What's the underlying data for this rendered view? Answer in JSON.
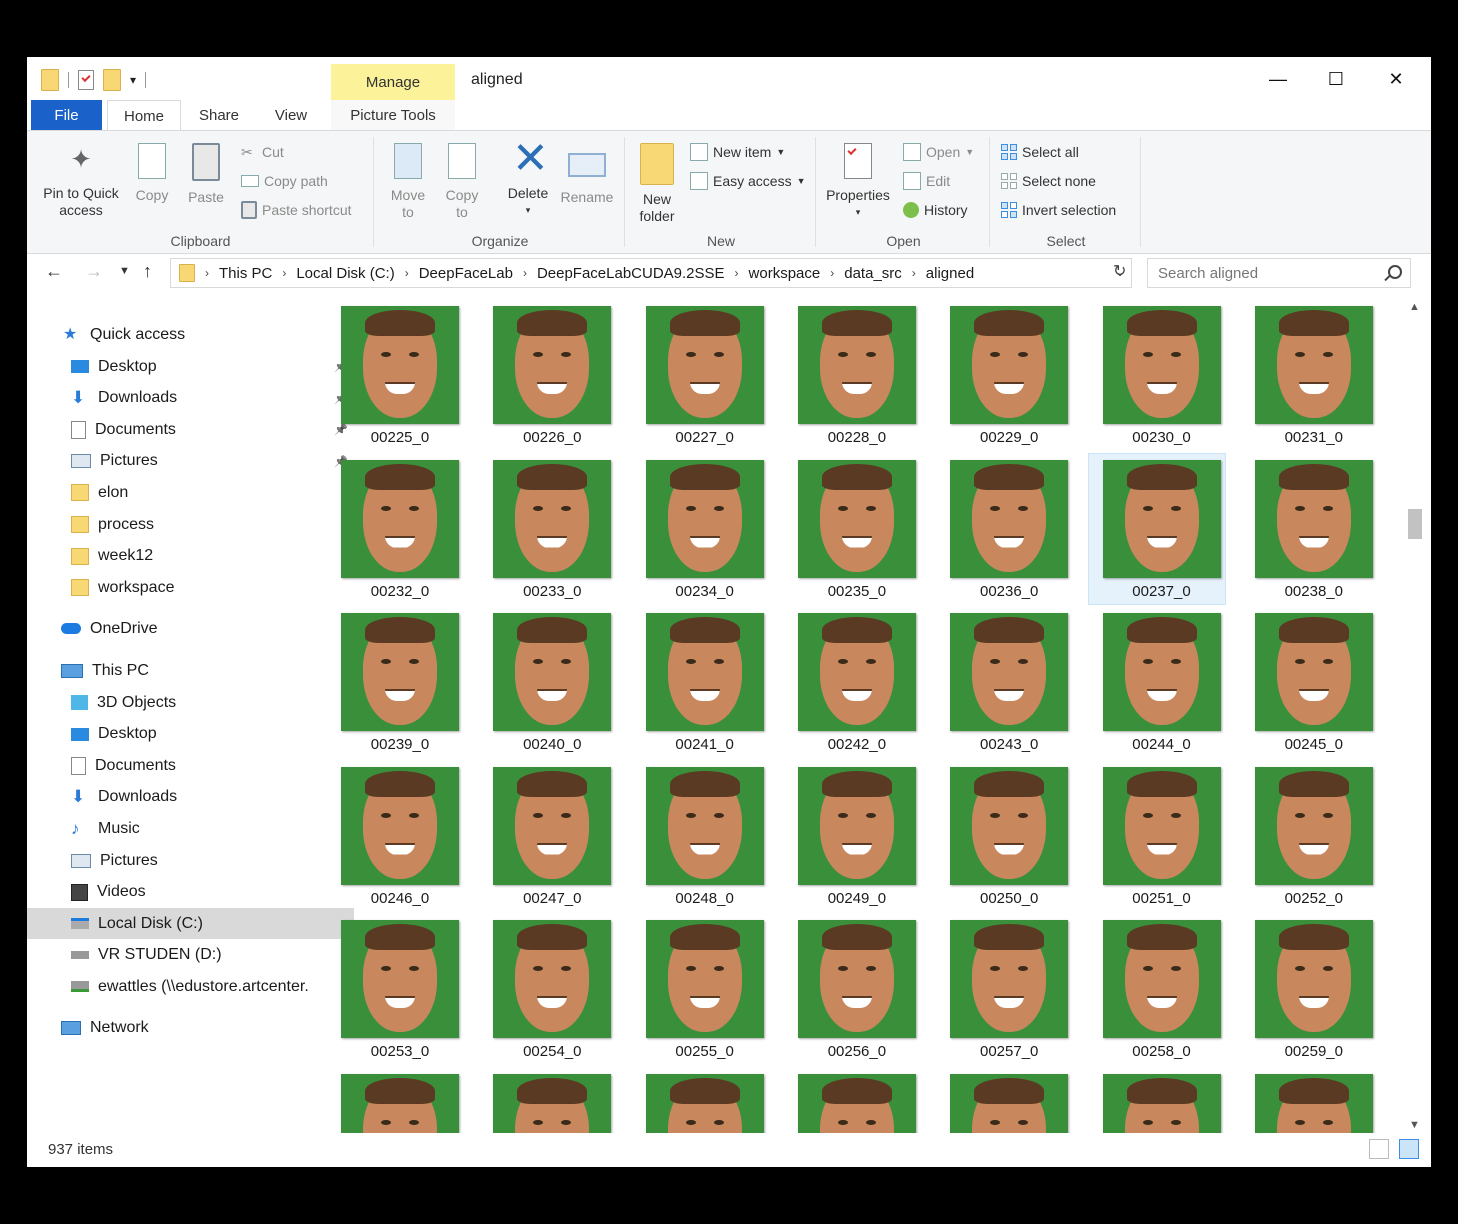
{
  "window": {
    "title": "aligned",
    "context_tab": "Manage",
    "controls": {
      "minimize": "—",
      "maximize": "☐",
      "close": "✕"
    }
  },
  "ribbon_tabs": {
    "file": "File",
    "home": "Home",
    "share": "Share",
    "view": "View",
    "picture_tools": "Picture Tools"
  },
  "ribbon": {
    "clipboard": {
      "label": "Clipboard",
      "pin": "Pin to Quick access",
      "copy": "Copy",
      "paste": "Paste",
      "cut": "Cut",
      "copy_path": "Copy path",
      "paste_shortcut": "Paste shortcut"
    },
    "organize": {
      "label": "Organize",
      "move_to": "Move to",
      "copy_to": "Copy to",
      "delete": "Delete",
      "rename": "Rename"
    },
    "new": {
      "label": "New",
      "new_folder": "New folder",
      "new_item": "New item",
      "easy_access": "Easy access"
    },
    "open": {
      "label": "Open",
      "properties": "Properties",
      "open": "Open",
      "edit": "Edit",
      "history": "History"
    },
    "select": {
      "label": "Select",
      "select_all": "Select all",
      "select_none": "Select none",
      "invert": "Invert selection"
    }
  },
  "address": {
    "breadcrumbs": [
      "This PC",
      "Local Disk (C:)",
      "DeepFaceLab",
      "DeepFaceLabCUDA9.2SSE",
      "workspace",
      "data_src",
      "aligned"
    ],
    "search_placeholder": "Search aligned"
  },
  "nav": {
    "quick_access": "Quick access",
    "quick_items": [
      {
        "label": "Desktop",
        "icon": "desktop-icon",
        "pinned": true
      },
      {
        "label": "Downloads",
        "icon": "download-icon",
        "pinned": true
      },
      {
        "label": "Documents",
        "icon": "documents-icon",
        "pinned": true
      },
      {
        "label": "Pictures",
        "icon": "pictures-icon",
        "pinned": true
      },
      {
        "label": "elon",
        "icon": "folder-icon",
        "pinned": false
      },
      {
        "label": "process",
        "icon": "folder-icon",
        "pinned": false
      },
      {
        "label": "week12",
        "icon": "folder-icon",
        "pinned": false
      },
      {
        "label": "workspace",
        "icon": "folder-icon",
        "pinned": false
      }
    ],
    "onedrive": "OneDrive",
    "this_pc": "This PC",
    "pc_items": [
      {
        "label": "3D Objects",
        "icon": "3d-objects-icon"
      },
      {
        "label": "Desktop",
        "icon": "desktop-icon"
      },
      {
        "label": "Documents",
        "icon": "documents-icon"
      },
      {
        "label": "Downloads",
        "icon": "download-icon"
      },
      {
        "label": "Music",
        "icon": "music-icon"
      },
      {
        "label": "Pictures",
        "icon": "pictures-icon"
      },
      {
        "label": "Videos",
        "icon": "videos-icon"
      },
      {
        "label": "Local Disk (C:)",
        "icon": "local-disk-icon",
        "selected": true
      },
      {
        "label": "VR STUDEN (D:)",
        "icon": "drive-icon"
      },
      {
        "label": "ewattles (\\\\edustore.artcenter.",
        "icon": "network-drive-icon"
      }
    ],
    "network": "Network"
  },
  "files": [
    "00225_0",
    "00226_0",
    "00227_0",
    "00228_0",
    "00229_0",
    "00230_0",
    "00231_0",
    "00232_0",
    "00233_0",
    "00234_0",
    "00235_0",
    "00236_0",
    "00237_0",
    "00238_0",
    "00239_0",
    "00240_0",
    "00241_0",
    "00242_0",
    "00243_0",
    "00244_0",
    "00245_0",
    "00246_0",
    "00247_0",
    "00248_0",
    "00249_0",
    "00250_0",
    "00251_0",
    "00252_0",
    "00253_0",
    "00254_0",
    "00255_0",
    "00256_0",
    "00257_0",
    "00258_0",
    "00259_0",
    "",
    "",
    "",
    "",
    "",
    "",
    ""
  ],
  "selected_file": "00237_0",
  "status": {
    "item_count": "937 items"
  },
  "colors": {
    "accent": "#1a62c9",
    "manage_tab": "#fbf29a",
    "thumb_bg": "#3a8f3a",
    "selected_bg": "#e5f1fb"
  }
}
